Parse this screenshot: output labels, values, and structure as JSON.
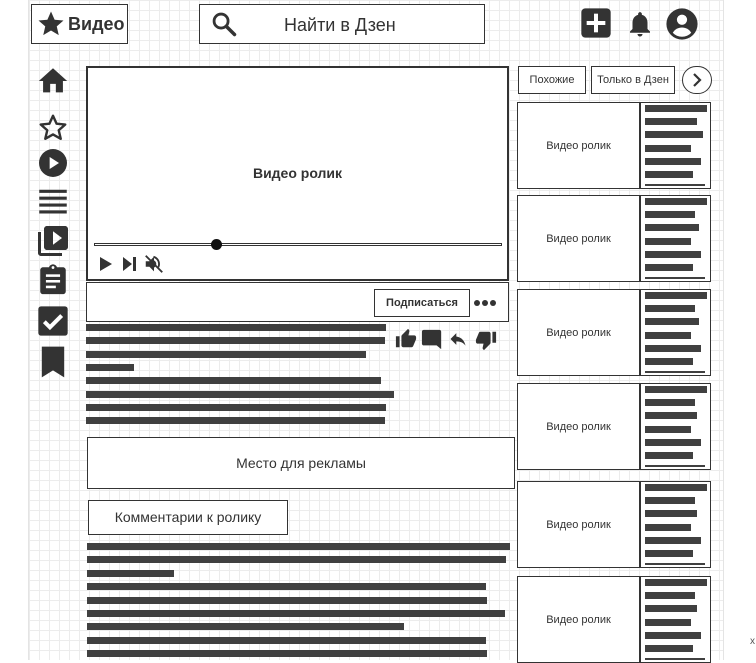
{
  "header": {
    "logo_text": "Видео",
    "search_placeholder": "Найти в Дзен",
    "actions": [
      "plus-icon",
      "bell-icon",
      "user-icon"
    ]
  },
  "sidebar": {
    "icons": [
      "home-icon",
      "star-outline-icon",
      "play-circle-icon",
      "menu-icon",
      "video-library-icon",
      "clipboard-icon",
      "checkbox-icon",
      "bookmark-icon"
    ]
  },
  "player": {
    "label": "Видео ролик",
    "progress": 0.3,
    "controls": [
      "play-icon",
      "skip-next-icon",
      "mute-icon"
    ]
  },
  "channel": {
    "subscribe_label": "Подписаться",
    "reactions": [
      "like-icon",
      "comment-icon",
      "reply-icon",
      "dislike-icon"
    ]
  },
  "ad": {
    "label": "Место для рекламы"
  },
  "comments": {
    "label": "Комментарии к ролику"
  },
  "related": {
    "chips": [
      "Похожие",
      "Только в Дзен"
    ],
    "card_label": "Видео ролик",
    "cards": [
      {
        "label": "Видео ролик"
      },
      {
        "label": "Видео ролик"
      },
      {
        "label": "Видео ролик"
      },
      {
        "label": "Видео ролик"
      },
      {
        "label": "Видео ролик"
      },
      {
        "label": "Видео ролик"
      }
    ]
  },
  "margin_note": "x"
}
